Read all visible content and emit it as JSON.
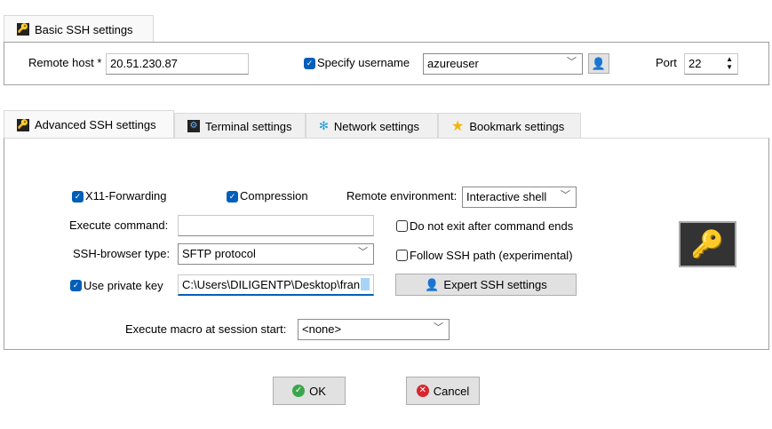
{
  "basic": {
    "tab_label": "Basic SSH settings",
    "remote_host_label": "Remote host *",
    "remote_host_value": "20.51.230.87",
    "specify_username_label": "Specify username",
    "specify_username_checked": true,
    "username_value": "azureuser",
    "port_label": "Port",
    "port_value": "22"
  },
  "tabs": [
    {
      "label": "Advanced SSH settings",
      "active": true
    },
    {
      "label": "Terminal settings"
    },
    {
      "label": "Network settings"
    },
    {
      "label": "Bookmark settings"
    }
  ],
  "advanced": {
    "x11_label": "X11-Forwarding",
    "compression_label": "Compression",
    "remote_env_label": "Remote environment:",
    "remote_env_value": "Interactive shell",
    "exec_cmd_label": "Execute command:",
    "exec_cmd_value": "",
    "no_exit_label": "Do not exit after command ends",
    "browser_type_label": "SSH-browser type:",
    "browser_type_value": "SFTP protocol",
    "follow_path_label": "Follow SSH path (experimental)",
    "private_key_label": "Use private key",
    "private_key_value": "C:\\Users\\DILIGENTP\\Desktop\\fran",
    "expert_label": "Expert SSH settings",
    "macro_label": "Execute macro at session start:",
    "macro_value": "<none>"
  },
  "buttons": {
    "ok": "OK",
    "cancel": "Cancel"
  }
}
